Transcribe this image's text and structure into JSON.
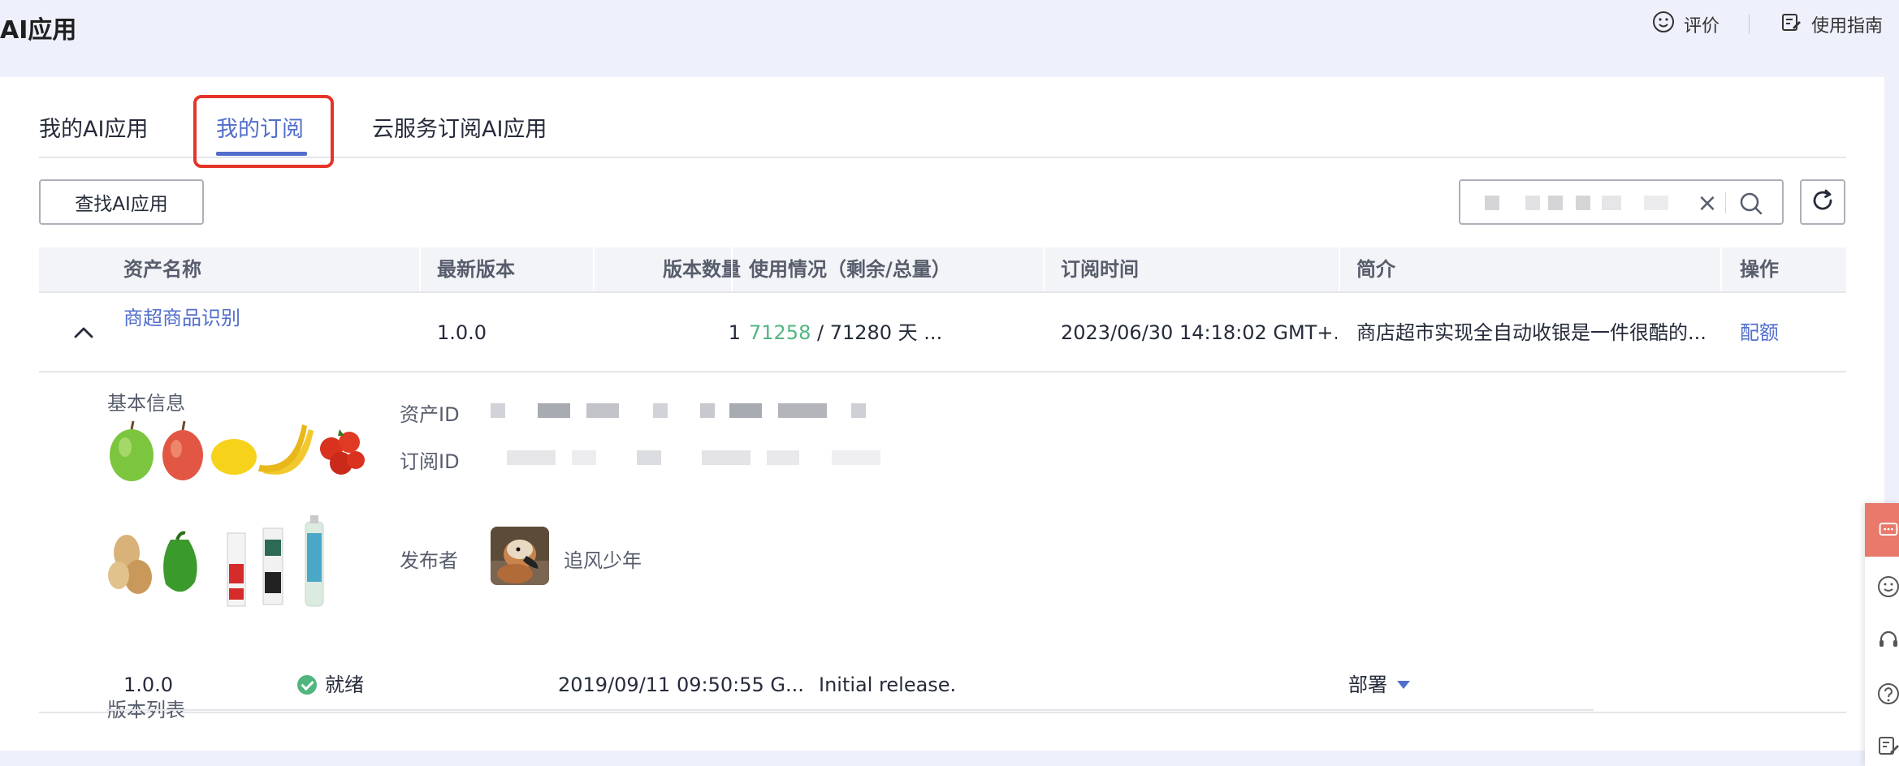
{
  "header": {
    "title": "AI应用",
    "actions": [
      {
        "label": "评价",
        "icon": "smiley-icon"
      },
      {
        "label": "使用指南",
        "icon": "guide-edit-icon"
      }
    ]
  },
  "tabs": [
    {
      "label": "我的AI应用",
      "active": false
    },
    {
      "label": "我的订阅",
      "active": true
    },
    {
      "label": "云服务订阅AI应用",
      "active": false
    }
  ],
  "toolbar": {
    "find_label": "查找AI应用",
    "search_value": ""
  },
  "table": {
    "columns": [
      "资产名称",
      "最新版本",
      "版本数量",
      "使用情况（剩余/总量）",
      "订阅时间",
      "简介",
      "操作"
    ],
    "rows": [
      {
        "name": "商超商品识别",
        "latest_version": "1.0.0",
        "version_count": "1",
        "usage_remaining": "71258",
        "usage_rest": " / 71280 天 ...",
        "subscribe_time": "2023/06/30 14:18:02 GMT+...",
        "description": "商店超市实现全自动收银是一件很酷的...",
        "action": "配额"
      }
    ]
  },
  "detail": {
    "basic_title": "基本信息",
    "asset_id_label": "资产ID",
    "subscription_id_label": "订阅ID",
    "publisher_label": "发布者",
    "publisher_name": "追风少年",
    "version_list_title": "版本列表",
    "versions": [
      {
        "version": "1.0.0",
        "status": "就绪",
        "time": "2019/09/11 09:50:55 G...",
        "note": "Initial release.",
        "action": "部署"
      }
    ]
  },
  "colors": {
    "primary": "#526ecc",
    "success": "#50b57f",
    "highlight": "#e5352b",
    "float_accent": "#e9796b"
  }
}
